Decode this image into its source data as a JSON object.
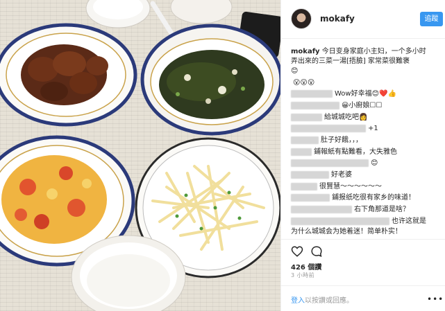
{
  "post": {
    "username": "mokafy",
    "follow_label": "追蹤",
    "caption_user": "mokafy",
    "caption_line1": "今日变身家庭小主妇，一个多小时",
    "caption_line2": "弄出來的三菜一湯[捂臉] 家常菜很難褒",
    "caption_line3": "😊"
  },
  "comments": [
    {
      "text": "😮😮😮"
    },
    {
      "text": "Wow好幸福😊❤️👍"
    },
    {
      "text": "😀小廚娘☐☐"
    },
    {
      "text": "給城城吃吧👩"
    },
    {
      "text": "+1"
    },
    {
      "text": "肚子好餓，，，"
    },
    {
      "text": "鋪報紙有點難看，大失雅色"
    },
    {
      "text": "😊"
    },
    {
      "text": "好老婆"
    },
    {
      "text": "很賢慧～～～～～～"
    },
    {
      "text": "鋪报纸吃很有家乡的味道！"
    },
    {
      "text": "右下角那道是啥？"
    },
    {
      "text": "也许这就是"
    },
    {
      "text": "为什么城城会为她着迷！简单朴实！"
    }
  ],
  "stats": {
    "likes": "426 個讚",
    "time_ago": "3 小時前"
  },
  "footer": {
    "login_link": "登入",
    "login_rest": "以按讚或回應。",
    "more": "•••"
  },
  "icons": {
    "heart": "heart-icon",
    "comment": "comment-icon",
    "more": "more-options-icon"
  }
}
